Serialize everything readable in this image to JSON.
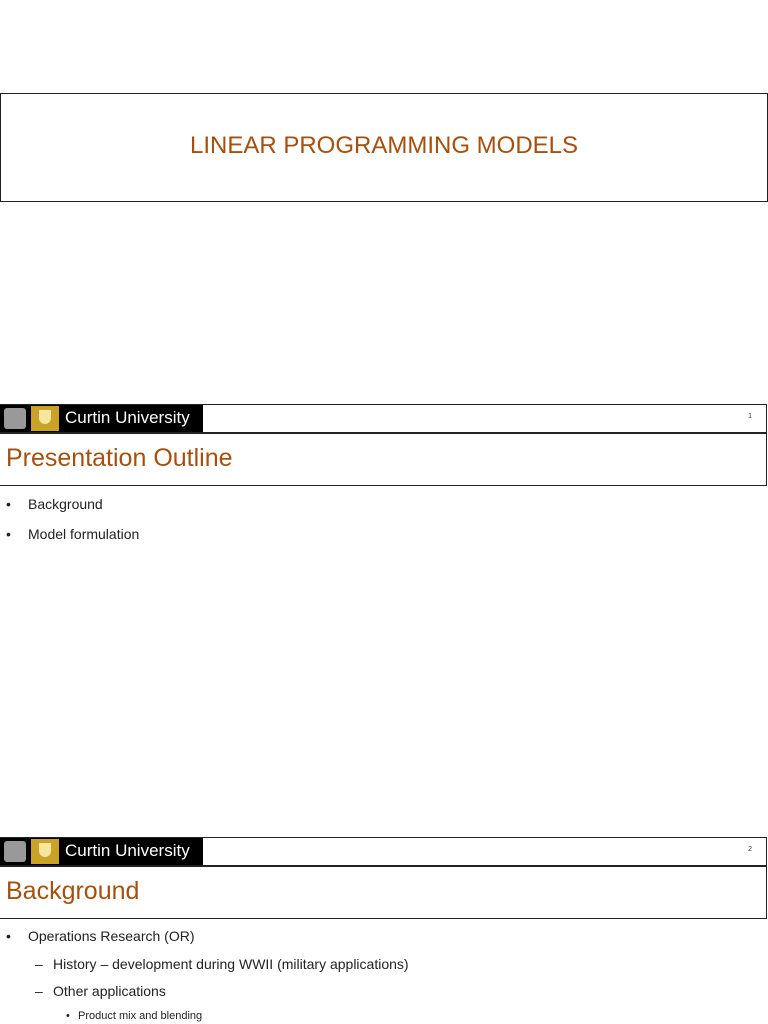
{
  "slide1": {
    "title": "LINEAR PROGRAMMING MODELS"
  },
  "header": {
    "brand": "Curtin University"
  },
  "slide2": {
    "page": "1",
    "title": "Presentation Outline",
    "bullets": [
      "Background",
      "Model formulation"
    ]
  },
  "slide3": {
    "page": "2",
    "title": "Background",
    "bullet": "Operations Research (OR)",
    "sub": [
      "History – development during WWII (military applications)",
      "Other applications"
    ],
    "subsub": [
      "Product mix and blending"
    ]
  }
}
